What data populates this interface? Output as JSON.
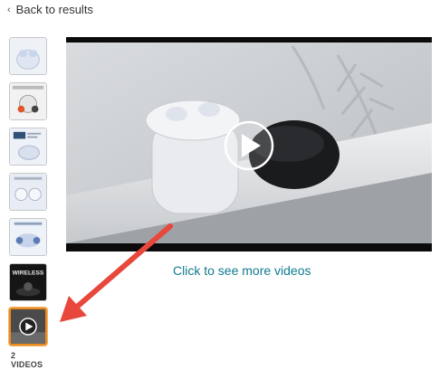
{
  "nav": {
    "back_label": "Back to results"
  },
  "thumbnails": [
    {
      "name": "thumb-earbuds-case"
    },
    {
      "name": "thumb-noise-cancellation"
    },
    {
      "name": "thumb-battery-hours"
    },
    {
      "name": "thumb-earbuds-fit"
    },
    {
      "name": "thumb-earbuds-features"
    },
    {
      "name": "thumb-wireless",
      "text": "WIRELESS"
    },
    {
      "name": "thumb-video",
      "active": true
    }
  ],
  "videos": {
    "count_label": "2 VIDEOS"
  },
  "player": {
    "cta": "Click to see more videos"
  },
  "colors": {
    "link": "#0f7b8e",
    "active_border": "#e98b1d",
    "arrow": "#e8473b"
  }
}
